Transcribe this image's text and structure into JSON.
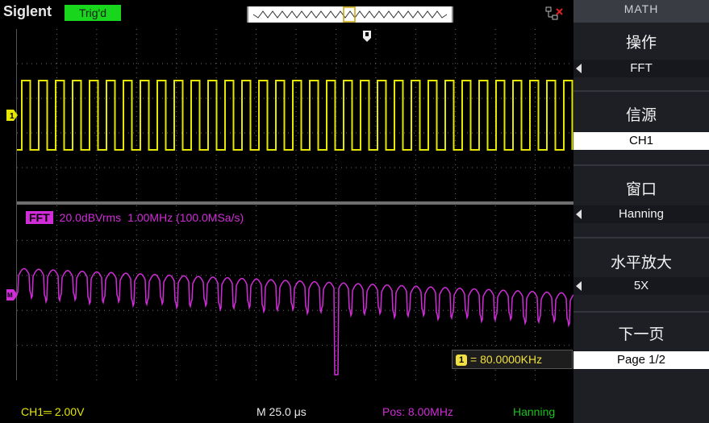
{
  "header": {
    "brand": "Siglent",
    "trigger_status": "Trig'd"
  },
  "colors": {
    "ch1_trace": "#e6e600",
    "math_trace": "#d02cd8",
    "trigger_badge": "#17d61b",
    "window_status": "#17c21b"
  },
  "fft": {
    "tag": "FFT",
    "scale": "20.0dBVrms",
    "center": "1.00MHz (100.0MSa/s)"
  },
  "cursor": {
    "badge": "1",
    "readout": "= 80.0000KHz"
  },
  "status": {
    "ch1_scale": "CH1═ 2.00V",
    "timebase": "M 25.0 μs",
    "position": "Pos: 8.00MHz",
    "window": "Hanning"
  },
  "menu": {
    "title": "MATH",
    "items": [
      {
        "label": "操作",
        "value": "FFT"
      },
      {
        "label": "信源",
        "value": "CH1"
      },
      {
        "label": "窗口",
        "value": "Hanning"
      },
      {
        "label": "水平放大",
        "value": "5X"
      },
      {
        "label": "下一页",
        "value": "Page 1/2"
      }
    ]
  }
}
